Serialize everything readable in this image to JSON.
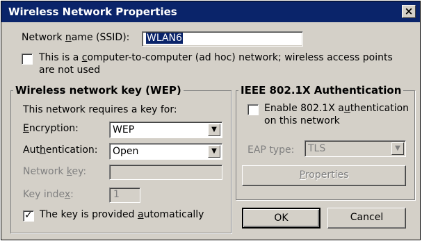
{
  "window": {
    "title": "Wireless Network Properties",
    "close_glyph": "×"
  },
  "ssid": {
    "label_pre": "Network ",
    "label_u": "n",
    "label_post": "ame (SSID):",
    "value": "WLAN6"
  },
  "adhoc": {
    "checked": false,
    "line1_pre": "This is a ",
    "line1_u": "c",
    "line1_post": "omputer-to-computer (ad hoc) network; wireless access points",
    "line2": "are not used"
  },
  "wep": {
    "group_title": "Wireless network key (WEP)",
    "intro": "This network requires a key for:",
    "encryption": {
      "label_u": "E",
      "label_post": "ncryption:",
      "value": "WEP"
    },
    "authentication": {
      "label_pre": "Aut",
      "label_u": "h",
      "label_post": "entication:",
      "value": "Open"
    },
    "network_key": {
      "label_pre": "Network ",
      "label_u": "k",
      "label_post": "ey:",
      "value": ""
    },
    "key_index": {
      "label_pre": "Key inde",
      "label_u": "x",
      "label_post": ":",
      "value": "1"
    },
    "auto_key": {
      "checked": true,
      "check_glyph": "✓",
      "label_pre": "The key is provided ",
      "label_u": "a",
      "label_post": "utomatically"
    }
  },
  "ieee": {
    "group_title": "IEEE 802.1X Authentication",
    "enable": {
      "checked": false,
      "line1_pre": "Enable 802.1X a",
      "line1_u": "u",
      "line1_post": "thentication",
      "line2": "on this network"
    },
    "eap": {
      "label": "EAP type:",
      "value": "TLS"
    },
    "properties": {
      "label_u": "P",
      "label_post": "roperties"
    }
  },
  "buttons": {
    "ok": "OK",
    "cancel": "Cancel"
  },
  "arrow_glyph": "▼"
}
